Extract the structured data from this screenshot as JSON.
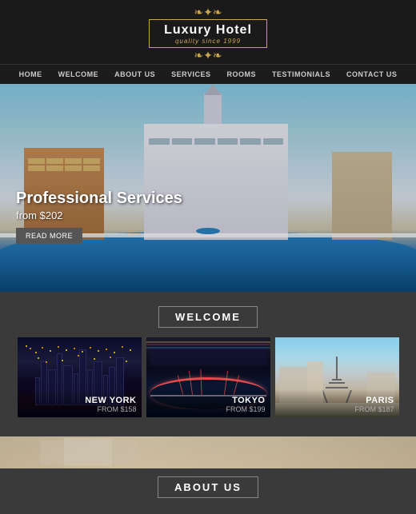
{
  "header": {
    "ornament_top": "❧✦❧",
    "logo_title": "Luxury Hotel",
    "logo_subtitle": "quality since 1999",
    "ornament_bottom": "❧✦❧"
  },
  "nav": {
    "items": [
      {
        "label": "HOME",
        "id": "home"
      },
      {
        "label": "WELCOME",
        "id": "welcome"
      },
      {
        "label": "ABOUT US",
        "id": "about"
      },
      {
        "label": "SERVICES",
        "id": "services"
      },
      {
        "label": "ROOMS",
        "id": "rooms"
      },
      {
        "label": "TESTIMONIALS",
        "id": "testimonials"
      },
      {
        "label": "CONTACT US",
        "id": "contact"
      }
    ]
  },
  "hero": {
    "title": "Professional Services",
    "price": "from $202",
    "button_label": "READ MORE"
  },
  "welcome": {
    "section_title": "WELCOME",
    "cities": [
      {
        "name": "NEW YORK",
        "price": "FROM $158",
        "theme": "ny"
      },
      {
        "name": "TOKYO",
        "price": "FROM $199",
        "theme": "tokyo"
      },
      {
        "name": "PARIS",
        "price": "FROM $187",
        "theme": "paris"
      }
    ]
  },
  "about": {
    "section_title": "ABOUT US"
  }
}
